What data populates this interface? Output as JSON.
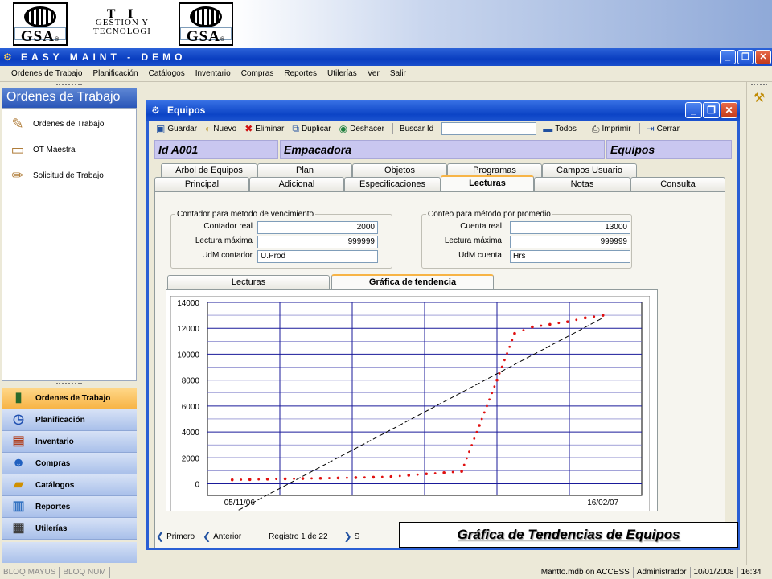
{
  "logos": {
    "left": "GSA",
    "ti_big": "T I",
    "ti_line1": "GESTION Y",
    "ti_line2": "TECNOLOGI",
    "right": "GSA",
    "reg": "®"
  },
  "app": {
    "title": "EASY MAINT - DEMO",
    "buttons": {
      "minimize": "_",
      "restore": "❐",
      "close": "✕"
    }
  },
  "menu": [
    "Ordenes de Trabajo",
    "Planificación",
    "Catálogos",
    "Inventario",
    "Compras",
    "Reportes",
    "Utilerías",
    "Ver",
    "Salir"
  ],
  "sidebar": {
    "header": "Ordenes de Trabajo",
    "items": [
      {
        "label": "Ordenes de Trabajo",
        "icon": "tools-icon"
      },
      {
        "label": "OT Maestra",
        "icon": "ruler-icon"
      },
      {
        "label": "Solicitud de Trabajo",
        "icon": "pencil-icon"
      }
    ],
    "nav": [
      {
        "label": "Ordenes de Trabajo",
        "icon": "book-icon"
      },
      {
        "label": "Planificación",
        "icon": "clock-icon"
      },
      {
        "label": "Inventario",
        "icon": "shelf-icon"
      },
      {
        "label": "Compras",
        "icon": "person-icon"
      },
      {
        "label": "Catálogos",
        "icon": "folder-icon"
      },
      {
        "label": "Reportes",
        "icon": "chart-icon"
      },
      {
        "label": "Utilerías",
        "icon": "server-icon"
      }
    ]
  },
  "child": {
    "title": "Equipos",
    "toolbar": {
      "guardar": "Guardar",
      "nuevo": "Nuevo",
      "eliminar": "Eliminar",
      "duplicar": "Duplicar",
      "deshacer": "Deshacer",
      "buscar": "Buscar Id",
      "todos": "Todos",
      "imprimir": "Imprimir",
      "cerrar": "Cerrar"
    },
    "header": {
      "id": "Id  A001",
      "name": "Empacadora",
      "category": "Equipos"
    },
    "tabs_row1": [
      "Arbol de Equipos",
      "Plan",
      "Objetos",
      "Programas",
      "Campos Usuario"
    ],
    "tabs_row2": [
      "Principal",
      "Adicional",
      "Especificaciones",
      "Lecturas",
      "Notas",
      "Consulta"
    ],
    "group1": {
      "title": "Contador para método de vencimiento",
      "labels": [
        "Contador real",
        "Lectura máxima",
        "UdM contador"
      ],
      "values": [
        "2000",
        "999999",
        "U.Prod"
      ]
    },
    "group2": {
      "title": "Conteo para método por promedio",
      "labels": [
        "Cuenta real",
        "Lectura máxima",
        "UdM cuenta"
      ],
      "values": [
        "13000",
        "999999",
        "Hrs"
      ]
    },
    "subtabs": [
      "Lecturas",
      "Gráfica de tendencia"
    ],
    "nav": {
      "first": "Primero",
      "prev": "Anterior",
      "record": "Registro 1 de 22",
      "next": "S"
    }
  },
  "caption": "Gráfica de Tendencias de Equipos",
  "status": [
    "BLOQ MAYUS",
    "BLOQ NUM",
    "",
    "Mantto.mdb on ACCESS",
    "Administrador",
    "10/01/2008",
    "16:34"
  ],
  "chart_data": {
    "type": "scatter",
    "title": "",
    "xlabel": "",
    "ylabel": "",
    "x_tick_labels": [
      "05/11/06",
      "16/02/07"
    ],
    "yticks": [
      0,
      2000,
      4000,
      6000,
      8000,
      10000,
      12000,
      14000
    ],
    "ylim": [
      -900,
      14000
    ],
    "grid": true,
    "series": [
      {
        "style": "dotted-markers",
        "color": "#e01010",
        "x": [
          0,
          1,
          2,
          3,
          4,
          5,
          6,
          7,
          8,
          9,
          10,
          11,
          12,
          13,
          14,
          15,
          16,
          17,
          18,
          19,
          20,
          21
        ],
        "values": [
          300,
          320,
          350,
          380,
          400,
          420,
          440,
          470,
          500,
          550,
          650,
          760,
          850,
          950,
          4500,
          8000,
          11600,
          12100,
          12300,
          12500,
          12800,
          13000
        ]
      },
      {
        "style": "dashed-trendline",
        "color": "#000000",
        "x": [
          0,
          21
        ],
        "values": [
          -2300,
          12800
        ]
      }
    ]
  }
}
